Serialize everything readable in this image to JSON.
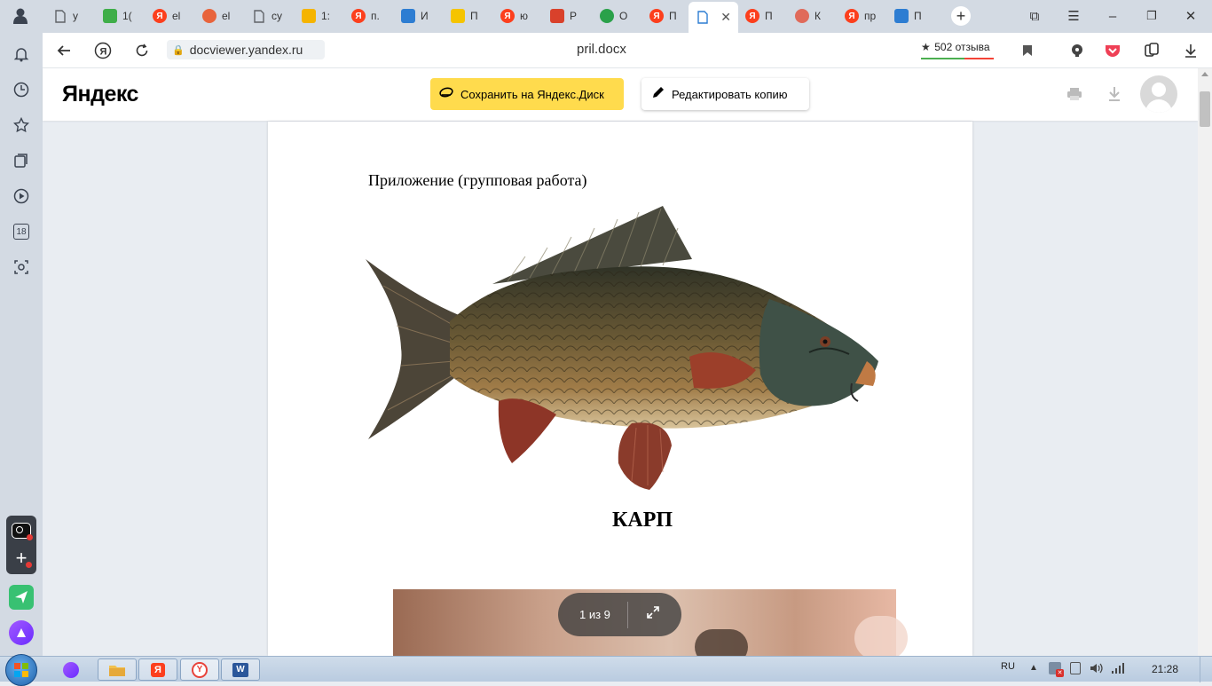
{
  "browser": {
    "tabs": [
      {
        "label": "у",
        "icon": "document-icon",
        "color": "#5f6368"
      },
      {
        "label": "1(",
        "icon": "green-square-icon",
        "color": "#3fae49"
      },
      {
        "label": "el",
        "icon": "yandex-icon",
        "color": "#fc3f1d"
      },
      {
        "label": "el",
        "icon": "orange-circle-icon",
        "color": "#e8643c"
      },
      {
        "label": "су",
        "icon": "document-icon",
        "color": "#5f6368"
      },
      {
        "label": "1:",
        "icon": "mail-icon",
        "color": "#f5b400"
      },
      {
        "label": "п.",
        "icon": "yandex-icon",
        "color": "#fc3f1d"
      },
      {
        "label": "И",
        "icon": "book-icon",
        "color": "#2d7dd2"
      },
      {
        "label": "П",
        "icon": "info-icon",
        "color": "#f5c400"
      },
      {
        "label": "ю",
        "icon": "yandex-icon",
        "color": "#fc3f1d"
      },
      {
        "label": "Р",
        "icon": "red-square-icon",
        "color": "#d9412b"
      },
      {
        "label": "О",
        "icon": "green-circle-icon",
        "color": "#2aa14a"
      },
      {
        "label": "П",
        "icon": "yandex-icon",
        "color": "#fc3f1d"
      },
      {
        "label": "",
        "icon": "doc-blue-icon",
        "color": "#2d7dd2",
        "active": true
      },
      {
        "label": "П",
        "icon": "yandex-icon",
        "color": "#fc3f1d"
      },
      {
        "label": "К",
        "icon": "pink-circle-icon",
        "color": "#e06a5a"
      },
      {
        "label": "пр",
        "icon": "yandex-icon",
        "color": "#fc3f1d"
      },
      {
        "label": "П",
        "icon": "check-icon",
        "color": "#2d7dd2"
      }
    ],
    "url": "docviewer.yandex.ru",
    "page_title": "pril.docx",
    "reviews": "502 отзыва"
  },
  "header": {
    "logo": "Яндекс",
    "save_button": "Сохранить на Яндекс.Диск",
    "edit_button": "Редактировать копию"
  },
  "document": {
    "caption_top": "Приложение (групповая работа)",
    "fish_label": "КАРП",
    "page_indicator": "1 из 9"
  },
  "sidebar": {
    "badge": "18"
  },
  "taskbar": {
    "lang": "RU",
    "time": "21:28"
  }
}
